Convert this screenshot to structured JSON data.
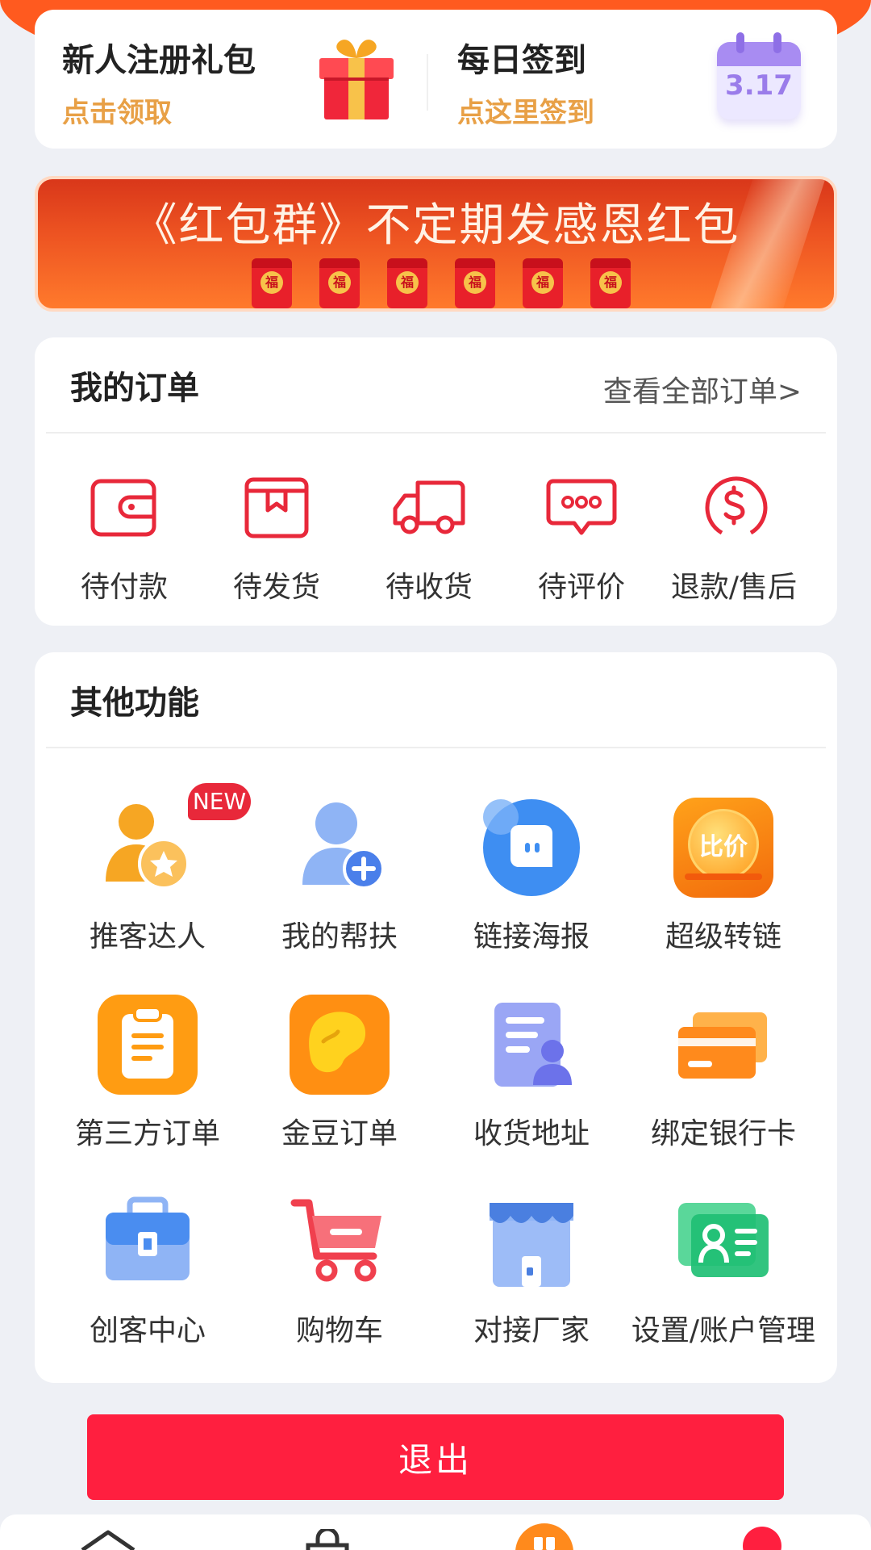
{
  "promo": {
    "register": {
      "title": "新人注册礼包",
      "sub": "点击领取"
    },
    "checkin": {
      "title": "每日签到",
      "sub": "点这里签到",
      "date": "3.17"
    }
  },
  "banner": {
    "text": "《红包群》不定期发感恩红包",
    "seal_char": "福"
  },
  "orders": {
    "title": "我的订单",
    "view_all": "查看全部订单>",
    "items": [
      {
        "label": "待付款",
        "icon": "wallet-icon"
      },
      {
        "label": "待发货",
        "icon": "box-icon"
      },
      {
        "label": "待收货",
        "icon": "truck-icon"
      },
      {
        "label": "待评价",
        "icon": "comment-icon"
      },
      {
        "label": "退款/售后",
        "icon": "refund-icon"
      }
    ]
  },
  "functions": {
    "title": "其他功能",
    "new_badge": "NEW",
    "compare_label": "比价",
    "items": [
      {
        "label": "推客达人",
        "icon": "user-star-icon"
      },
      {
        "label": "我的帮扶",
        "icon": "user-add-icon"
      },
      {
        "label": "链接海报",
        "icon": "chat-bubble-icon"
      },
      {
        "label": "超级转链",
        "icon": "compare-price-icon"
      },
      {
        "label": "第三方订单",
        "icon": "clipboard-icon"
      },
      {
        "label": "金豆订单",
        "icon": "bean-icon"
      },
      {
        "label": "收货地址",
        "icon": "address-icon"
      },
      {
        "label": "绑定银行卡",
        "icon": "bank-card-icon"
      },
      {
        "label": "创客中心",
        "icon": "briefcase-icon"
      },
      {
        "label": "购物车",
        "icon": "cart-icon"
      },
      {
        "label": "对接厂家",
        "icon": "store-icon"
      },
      {
        "label": "设置/账户管理",
        "icon": "id-card-icon"
      }
    ]
  },
  "logout_label": "退出",
  "colors": {
    "accent_red": "#ff1f3f",
    "icon_red": "#e8283a",
    "promo_orange": "#e8a046"
  }
}
